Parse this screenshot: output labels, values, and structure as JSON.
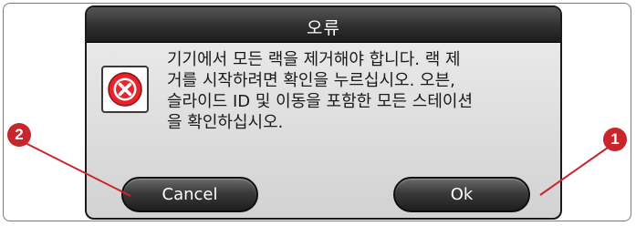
{
  "dialog": {
    "title": "오류",
    "icon": "error-x-icon",
    "message_lines": [
      "기기에서 모든 랙을 제거해야 합니다. 랙 제",
      "거를 시작하려면 확인을 누르십시오. 오븐,",
      "슬라이드 ID 및 이동을 포함한 모든 스테이션",
      "을 확인하십시오."
    ],
    "cancel_label": "Cancel",
    "ok_label": "Ok"
  },
  "callouts": {
    "left": "2",
    "right": "1"
  },
  "colors": {
    "callout": "#c9252c",
    "icon_red": "#e3262c",
    "title_bar": "#2f2f2f"
  }
}
